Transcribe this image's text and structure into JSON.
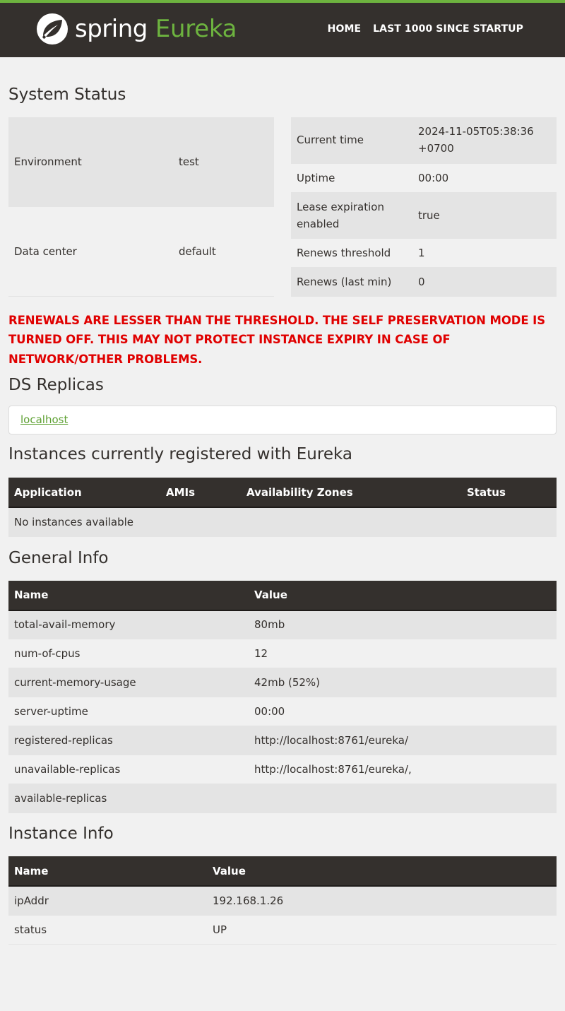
{
  "header": {
    "brand": "spring",
    "product": "Eureka",
    "nav": [
      "HOME",
      "LAST 1000 SINCE STARTUP"
    ]
  },
  "system_status": {
    "title": "System Status",
    "left": [
      {
        "key": "Environment",
        "value": "test"
      },
      {
        "key": "Data center",
        "value": "default"
      }
    ],
    "right": [
      {
        "key": "Current time",
        "value": "2024-11-05T05:38:36 +0700"
      },
      {
        "key": "Uptime",
        "value": "00:00"
      },
      {
        "key": "Lease expiration enabled",
        "value": "true"
      },
      {
        "key": "Renews threshold",
        "value": "1"
      },
      {
        "key": "Renews (last min)",
        "value": "0"
      }
    ]
  },
  "warning": "RENEWALS ARE LESSER THAN THE THRESHOLD. THE SELF PRESERVATION MODE IS TURNED OFF. THIS MAY NOT PROTECT INSTANCE EXPIRY IN CASE OF NETWORK/OTHER PROBLEMS.",
  "ds_replicas": {
    "title": "DS Replicas",
    "link": "localhost"
  },
  "instances": {
    "title": "Instances currently registered with Eureka",
    "columns": [
      "Application",
      "AMIs",
      "Availability Zones",
      "Status"
    ],
    "empty": "No instances available"
  },
  "general_info": {
    "title": "General Info",
    "columns": [
      "Name",
      "Value"
    ],
    "rows": [
      [
        "total-avail-memory",
        "80mb"
      ],
      [
        "num-of-cpus",
        "12"
      ],
      [
        "current-memory-usage",
        "42mb (52%)"
      ],
      [
        "server-uptime",
        "00:00"
      ],
      [
        "registered-replicas",
        "http://localhost:8761/eureka/"
      ],
      [
        "unavailable-replicas",
        "http://localhost:8761/eureka/,"
      ],
      [
        "available-replicas",
        ""
      ]
    ]
  },
  "instance_info": {
    "title": "Instance Info",
    "columns": [
      "Name",
      "Value"
    ],
    "rows": [
      [
        "ipAddr",
        "192.168.1.26"
      ],
      [
        "status",
        "UP"
      ]
    ]
  },
  "colors": {
    "header_bg": "#34302d",
    "accent_green": "#6db33f",
    "warning_red": "#e00000",
    "stripe": "#e4e4e4",
    "page_bg": "#f1f1f1"
  },
  "icons": [
    "spring-leaf-logo-icon"
  ]
}
